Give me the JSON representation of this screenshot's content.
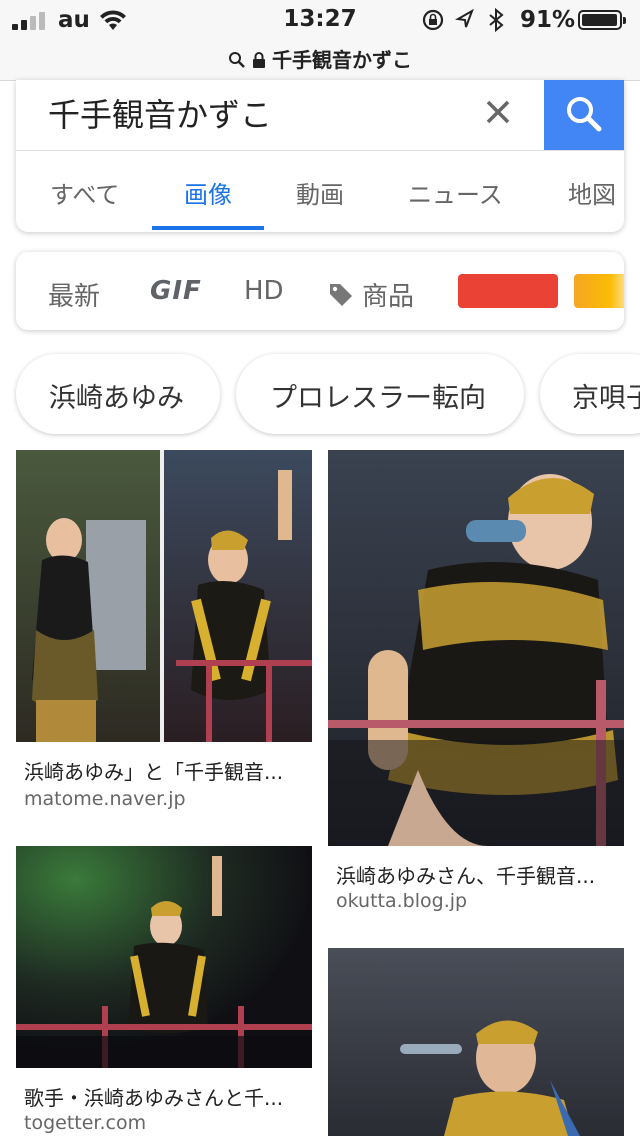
{
  "status_bar": {
    "carrier": "au",
    "time": "13:27",
    "battery": "91%",
    "battery_level": 0.91,
    "icons": [
      "signal-icon",
      "wifi-icon",
      "rotation-lock-icon",
      "location-icon",
      "bluetooth-icon",
      "battery-icon"
    ]
  },
  "url_bar": {
    "text": "千手観音かずこ",
    "icons": [
      "search-icon",
      "lock-icon"
    ]
  },
  "search": {
    "query": "千手観音かずこ",
    "accent": "#4285f4"
  },
  "tabs": [
    {
      "label": "すべて"
    },
    {
      "label": "画像",
      "active": true
    },
    {
      "label": "動画"
    },
    {
      "label": "ニュース"
    },
    {
      "label": "地図"
    }
  ],
  "filters": {
    "newest": "最新",
    "gif": "GIF",
    "hd": "HD",
    "products": "商品",
    "colors": [
      "#ea4335",
      "#fbbc05"
    ]
  },
  "chips": [
    {
      "label": "浜崎あゆみ"
    },
    {
      "label": "プロレスラー転向"
    },
    {
      "label": "京唄子"
    }
  ],
  "results": [
    {
      "title": "浜崎あゆみ」と「千手観音...",
      "domain": "matome.naver.jp"
    },
    {
      "title": "浜崎あゆみさん、千手観音...",
      "domain": "okutta.blog.jp"
    },
    {
      "title": "歌手・浜崎あゆみさんと千...",
      "domain": "togetter.com"
    },
    {
      "title": "",
      "domain": ""
    }
  ]
}
